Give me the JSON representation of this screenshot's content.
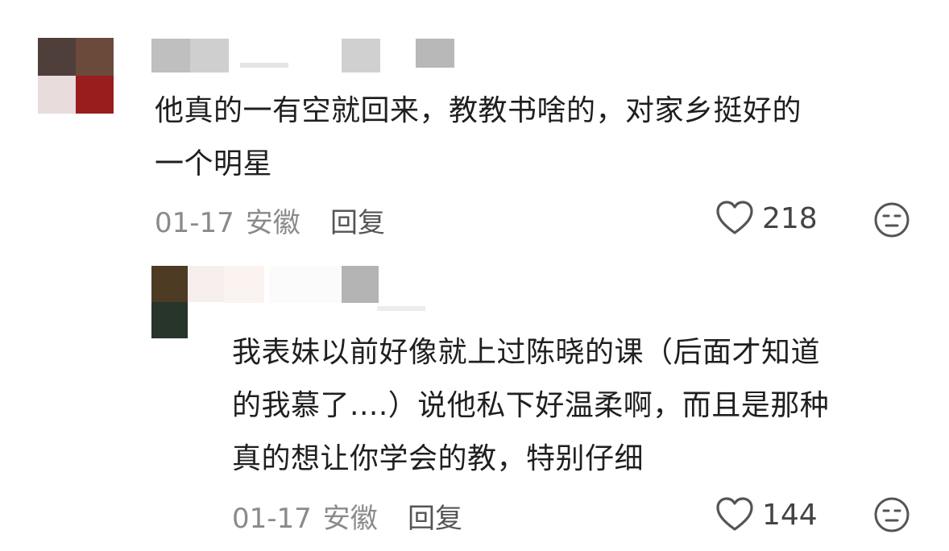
{
  "comments": [
    {
      "text_lines": [
        "他真的一有空就回来，教教书啥的，对家乡挺好的",
        "一个明星"
      ],
      "date": "01-17",
      "region": "安徽",
      "reply_label": "回复",
      "likes": "218"
    },
    {
      "text_lines": [
        "我表妹以前好像就上过陈晓的课（后面才知道",
        "的我慕了....）说他私下好温柔啊，而且是那种",
        "真的想让你学会的教，特别仔细"
      ],
      "date": "01-17",
      "region": "安徽",
      "reply_label": "回复",
      "likes": "144"
    }
  ],
  "icons": {
    "like": "heart-outline-icon",
    "dislike": "dislike-face-icon"
  },
  "colors": {
    "text": "#1f1f1f",
    "meta": "#8a8a8a",
    "icon": "#555555"
  }
}
